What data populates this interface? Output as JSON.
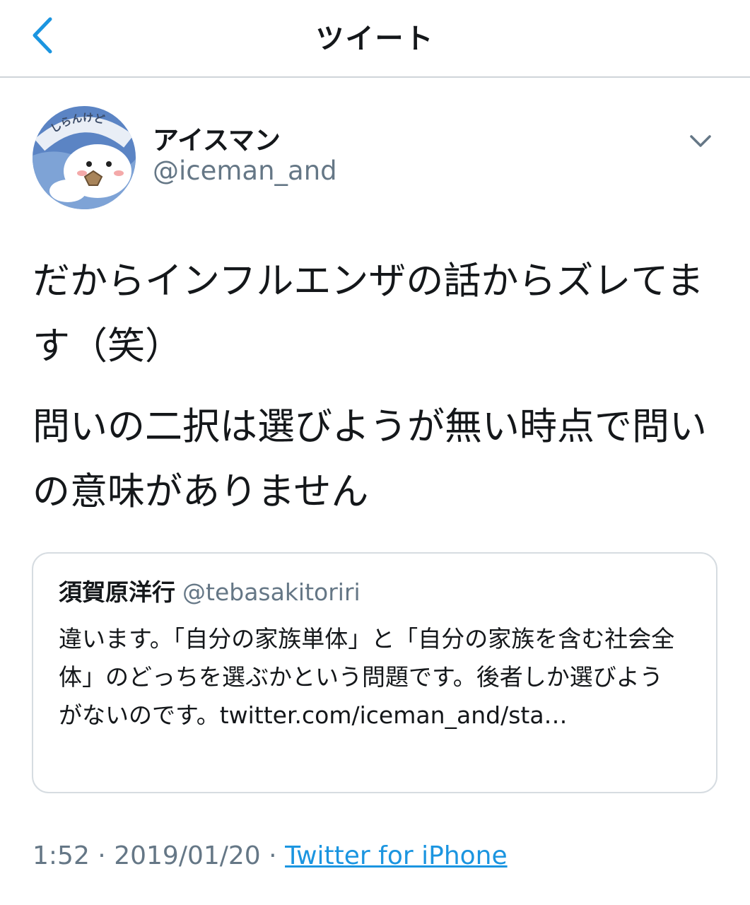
{
  "header": {
    "title": "ツイート",
    "back_icon": "chevron-left-icon"
  },
  "author": {
    "name": "アイスマン",
    "handle": "@iceman_and",
    "avatar_text": "しらんけど",
    "more_icon": "chevron-down-icon"
  },
  "tweet": {
    "paragraphs": [
      "だからインフルエンザの話からズレてます（笑）",
      "問いの二択は選びようが無い時点で問いの意味がありません"
    ]
  },
  "quote": {
    "name": "須賀原洋行",
    "handle": "@tebasakitoriri",
    "text": "違います。「自分の家族単体」と「自分の家族を含む社会全体」のどっちを選ぶかという問題です。後者しか選びようがないのです。twitter.com/iceman_and/sta…"
  },
  "meta": {
    "time": "1:52",
    "separator": "·",
    "date": "2019/01/20",
    "source": "Twitter for iPhone"
  },
  "colors": {
    "accent": "#1b95e0",
    "secondary_text": "#657786",
    "border": "#d6dce1"
  }
}
